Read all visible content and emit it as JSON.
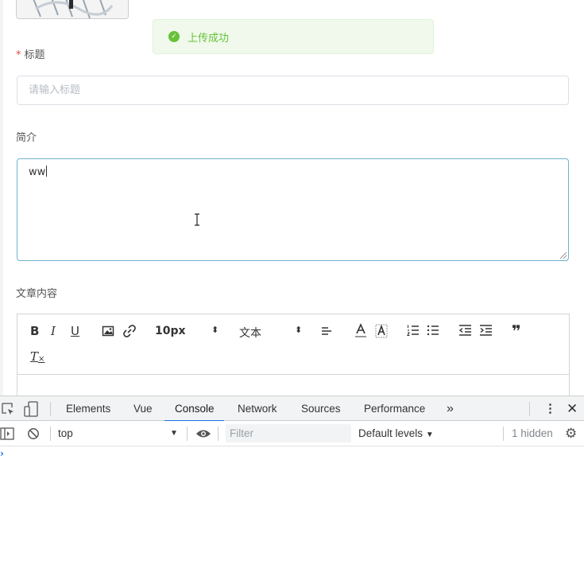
{
  "toast": {
    "message": "上传成功",
    "icon": "check-circle-icon"
  },
  "form": {
    "title_label_required": "*",
    "title_label": "标题",
    "title_placeholder": "请输入标题",
    "summary_label": "简介",
    "summary_value": "ww",
    "content_label": "文章内容"
  },
  "editor_toolbar": {
    "bold": "B",
    "italic": "I",
    "underline": "U",
    "size": "10px",
    "font": "文本",
    "clean": "T"
  },
  "devtools": {
    "tabs": [
      "Elements",
      "Vue",
      "Console",
      "Network",
      "Sources",
      "Performance"
    ],
    "more": "»",
    "active_tab": "Console",
    "context": "top",
    "filter_placeholder": "Filter",
    "levels": "Default levels",
    "hidden_count": "1 hidden",
    "prompt": "›"
  },
  "colors": {
    "success": "#67c23a",
    "accent": "#1a73e8",
    "focus_border": "#6fb3cc"
  }
}
